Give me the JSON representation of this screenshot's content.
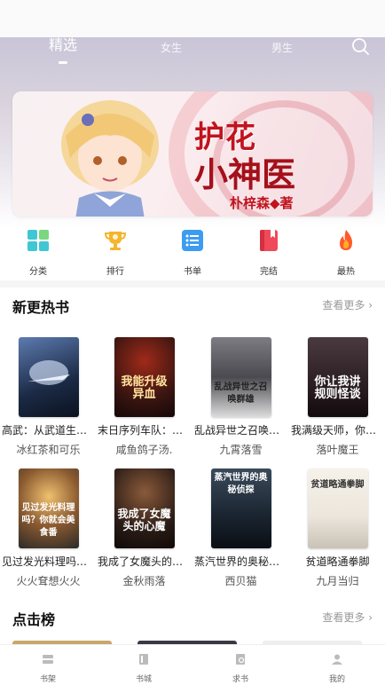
{
  "tabs": [
    {
      "label": "精选",
      "active": true
    },
    {
      "label": "女生",
      "active": false
    },
    {
      "label": "男生",
      "active": false
    }
  ],
  "banner": {
    "title_line1": "护花",
    "title_line2": "小神医",
    "author": "朴梓森◆著"
  },
  "quick_links": [
    {
      "label": "分类",
      "icon": "category-icon",
      "color": "#3fc7d3"
    },
    {
      "label": "排行",
      "icon": "trophy-icon",
      "color": "#f5b52e"
    },
    {
      "label": "书单",
      "icon": "list-icon",
      "color": "#3d9cf0"
    },
    {
      "label": "完结",
      "icon": "book-icon",
      "color": "#f04a5a"
    },
    {
      "label": "最热",
      "icon": "flame-icon",
      "color": "#ff5a2a"
    }
  ],
  "new_hot": {
    "title": "新更热书",
    "see_more": "查看更多",
    "books": [
      {
        "name": "高武：从武道生到...",
        "author": "冰红茶和可乐",
        "cover_text": "",
        "cover_color": "#1b2a45"
      },
      {
        "name": "末日序列车队：我...",
        "author": "咸鱼鸽子汤.",
        "cover_text": "我能升级异血",
        "cover_color": "#3a1510"
      },
      {
        "name": "乱战异世之召唤群雄",
        "author": "九霄落雪",
        "cover_text": "乱战异世之召唤群雄",
        "cover_color": "#4a4a50"
      },
      {
        "name": "我满级天师，你让...",
        "author": "落叶魔王",
        "cover_text": "你让我讲规则怪谈",
        "cover_color": "#2a1e22"
      },
      {
        "name": "见过发光料理吗，...",
        "author": "火火耷想火火",
        "cover_text": "见过发光料理吗？你就会美食番",
        "cover_color": "#2c2a28"
      },
      {
        "name": "我成了女魔头的心魔",
        "author": "金秋雨落",
        "cover_text": "我成了女魔头的心魔",
        "cover_color": "#2a1c16"
      },
      {
        "name": "蒸汽世界的奥秘侦探",
        "author": "西贝猫",
        "cover_text": "蒸汽世界的奥秘侦探",
        "cover_color": "#1a2430"
      },
      {
        "name": "贫道略通拳脚",
        "author": "九月当归",
        "cover_text": "贫道略通拳脚",
        "cover_color": "#ece6dc"
      }
    ]
  },
  "click_rank": {
    "title": "点击榜",
    "see_more": "查看更多"
  },
  "bottom_nav": [
    {
      "label": "书架",
      "icon": "bookshelf-icon"
    },
    {
      "label": "书城",
      "icon": "bookstore-icon"
    },
    {
      "label": "求书",
      "icon": "request-book-icon"
    },
    {
      "label": "我的",
      "icon": "profile-icon"
    }
  ]
}
